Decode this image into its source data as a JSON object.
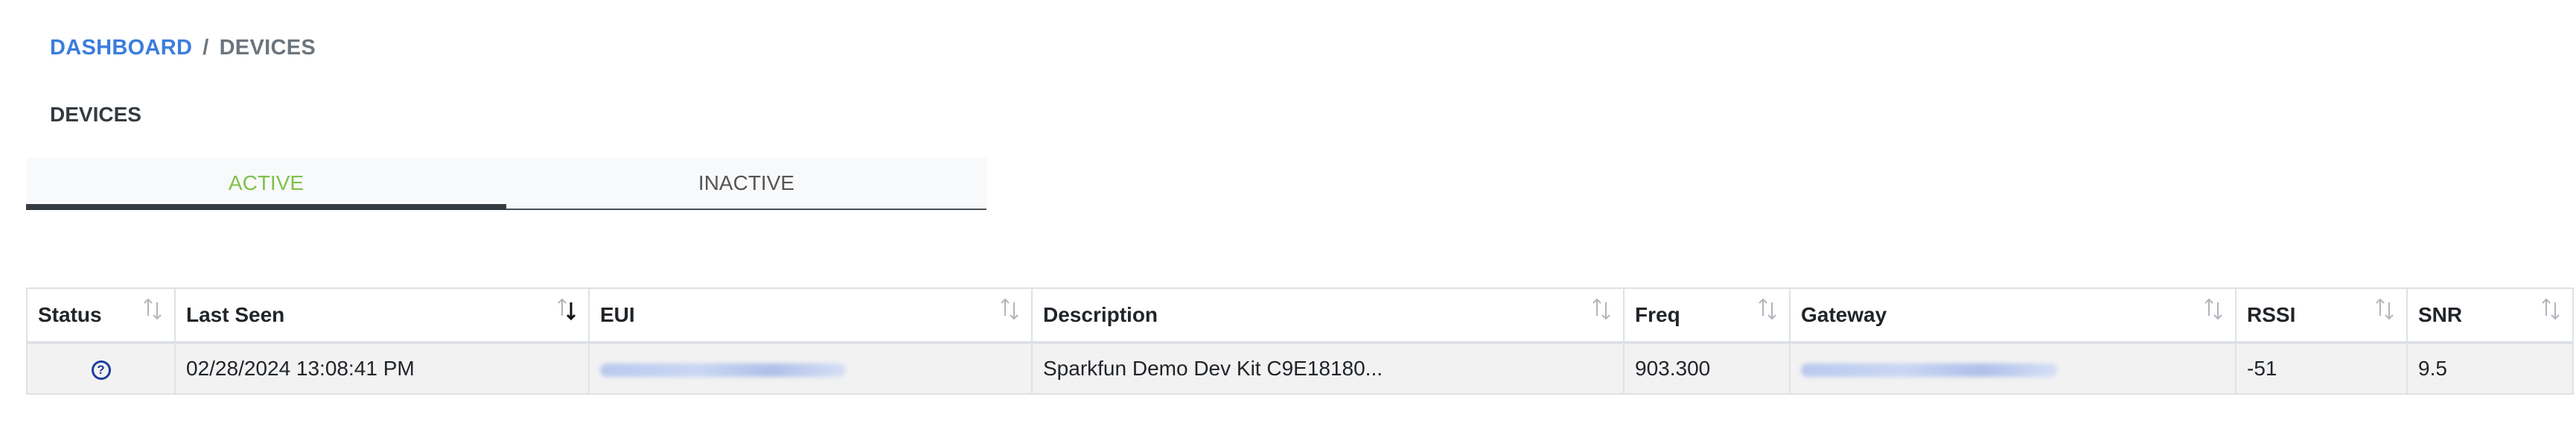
{
  "breadcrumb": {
    "home": "DASHBOARD",
    "separator": "/",
    "current": "DEVICES"
  },
  "page": {
    "title": "DEVICES"
  },
  "tabs": [
    {
      "label": "ACTIVE",
      "active": true
    },
    {
      "label": "INACTIVE",
      "active": false
    }
  ],
  "table": {
    "columns": [
      {
        "label": "Status",
        "sort": "none"
      },
      {
        "label": "Last Seen",
        "sort": "descending"
      },
      {
        "label": "EUI",
        "sort": "none"
      },
      {
        "label": "Description",
        "sort": "none"
      },
      {
        "label": "Freq",
        "sort": "none"
      },
      {
        "label": "Gateway",
        "sort": "none"
      },
      {
        "label": "RSSI",
        "sort": "none"
      },
      {
        "label": "SNR",
        "sort": "none"
      }
    ],
    "rows": [
      {
        "status_icon": "question-circle-icon",
        "last_seen": "02/28/2024 13:08:41 PM",
        "eui": "",
        "description": "Sparkfun Demo Dev Kit C9E18180...",
        "freq": "903.300",
        "gateway": "",
        "rssi": "-51",
        "snr": "9.5"
      }
    ]
  },
  "colors": {
    "link": "#3b7ddd",
    "active_tab": "#7dc24b",
    "tab_indicator": "#343a40",
    "status_icon": "#1d3fa0"
  }
}
